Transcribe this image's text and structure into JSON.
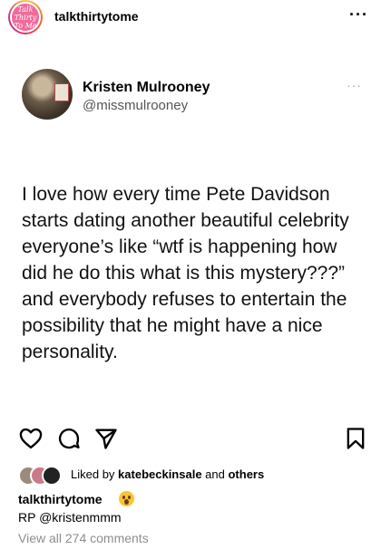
{
  "post": {
    "account": "talkthirtytome",
    "avatar_text": "Talk Thirty To Me",
    "more_icon": "more-horizontal-icon"
  },
  "tweet": {
    "name": "Kristen Mulrooney",
    "handle": "@missmulrooney",
    "text": "I love how every time Pete Davidson starts dating another beautiful celebrity everyone’s like “wtf is happening how did he do this what is this mystery???” and everybody refuses to entertain the possibility that he might have a nice personality."
  },
  "actions": {
    "like_icon": "heart-icon",
    "comment_icon": "comment-icon",
    "share_icon": "send-icon",
    "save_icon": "bookmark-icon"
  },
  "likes": {
    "prefix": "Liked by ",
    "user": "katebeckinsale",
    "middle": " and ",
    "others": "others"
  },
  "caption": {
    "username": "talkthirtytome",
    "emoji": "astonished-face-emoji",
    "text": "RP @kristenmmm"
  },
  "comments": {
    "view_all": "View all 274 comments"
  },
  "colors": {
    "ring_accent": "#e1306c",
    "avatar_bg": "#f06a9b",
    "muted_text": "#8e8e8e"
  }
}
